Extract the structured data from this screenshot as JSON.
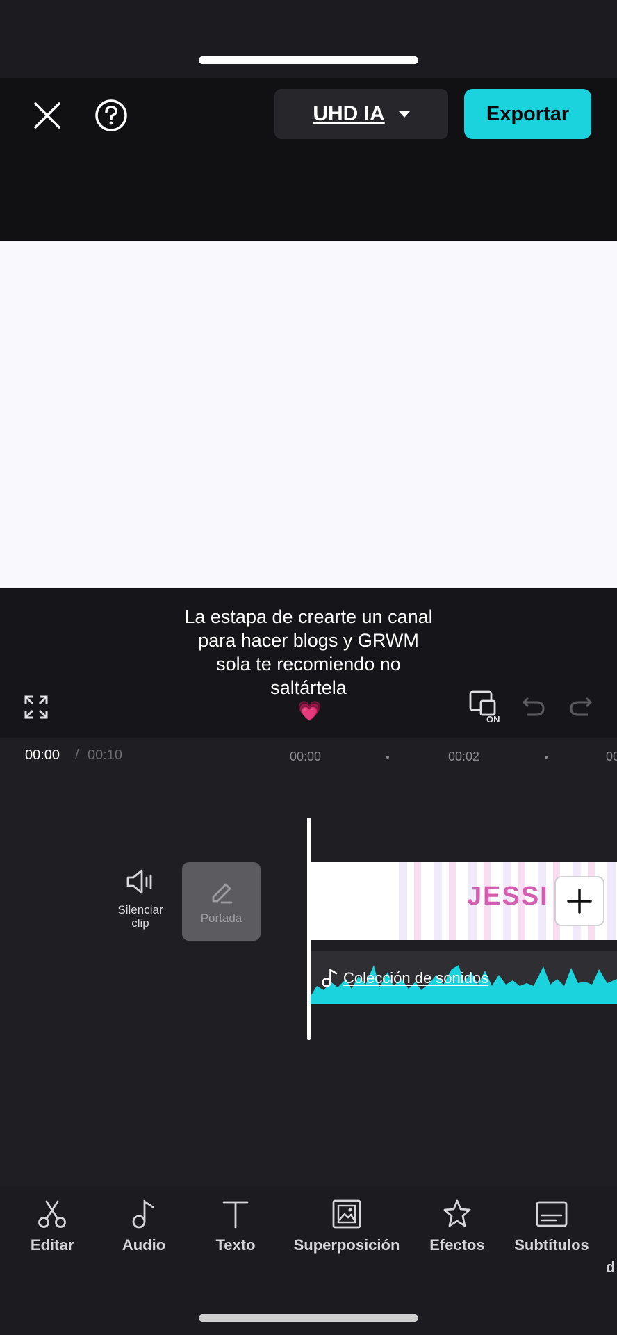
{
  "header": {
    "quality_label": "UHD IA",
    "export_label": "Exportar"
  },
  "caption": {
    "text": "La estapa de crearte un canal para hacer blogs y GRWM sola te recomiendo no saltártela",
    "emoji": "💗"
  },
  "timeline": {
    "current_time": "00:00",
    "separator": "/",
    "total_time": "00:10",
    "ruler_ticks": [
      "00:00",
      "00:02",
      "00"
    ],
    "mute_label": "Silenciar clip",
    "cover_label": "Portada",
    "clip_text": "JESSI J",
    "audio_label": "Colección de sonidos"
  },
  "toolbar": {
    "items": [
      {
        "label": "Editar",
        "icon": "scissors-icon"
      },
      {
        "label": "Audio",
        "icon": "music-note-icon"
      },
      {
        "label": "Texto",
        "icon": "text-icon"
      },
      {
        "label": "Superposición",
        "icon": "overlay-icon"
      },
      {
        "label": "Efectos",
        "icon": "effects-star-icon"
      },
      {
        "label": "Subtítulos",
        "icon": "subtitles-icon"
      }
    ],
    "partial_label": "d"
  },
  "colors": {
    "accent": "#1bd3dd",
    "background": "#1f1e23",
    "preview": "#f9f9fd"
  }
}
